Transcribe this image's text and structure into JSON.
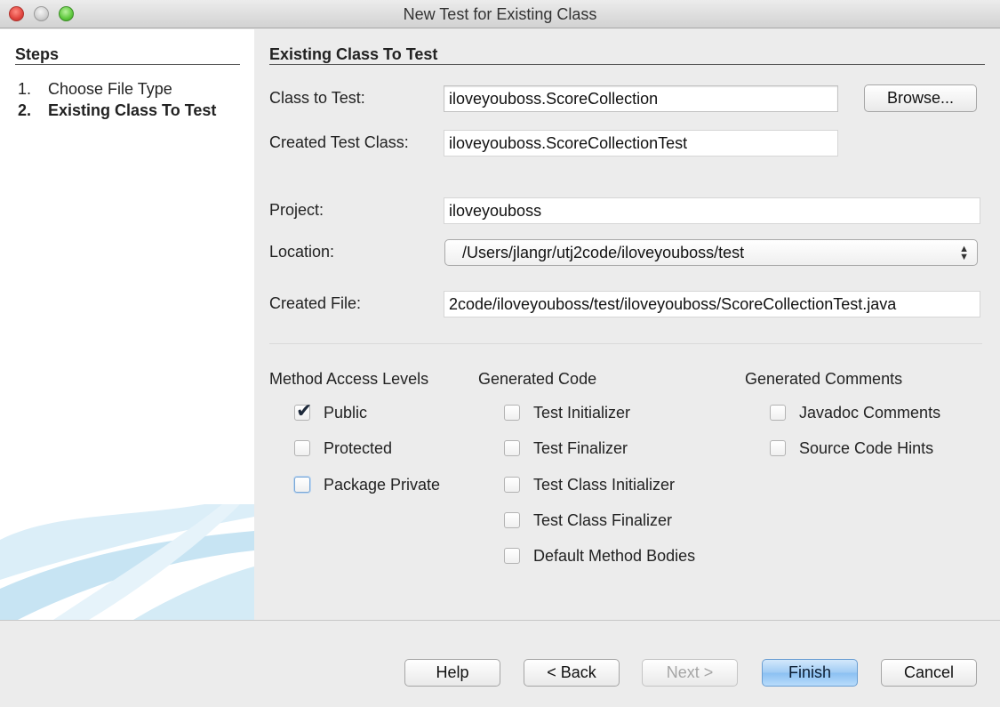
{
  "window": {
    "title": "New Test for Existing Class"
  },
  "steps": {
    "heading": "Steps",
    "items": [
      {
        "num": "1.",
        "label": "Choose File Type"
      },
      {
        "num": "2.",
        "label": "Existing Class To Test"
      }
    ]
  },
  "main": {
    "title": "Existing Class To Test",
    "class_to_test": {
      "label": "Class to Test:",
      "value": "iloveyouboss.ScoreCollection"
    },
    "browse_button": "Browse...",
    "created_test_class": {
      "label": "Created Test Class:",
      "value": "iloveyouboss.ScoreCollectionTest"
    },
    "project": {
      "label": "Project:",
      "value": "iloveyouboss"
    },
    "location": {
      "label": "Location:",
      "value": "/Users/jlangr/utj2code/iloveyouboss/test"
    },
    "created_file": {
      "label": "Created File:",
      "value": "2code/iloveyouboss/test/iloveyouboss/ScoreCollectionTest.java"
    }
  },
  "options": {
    "method_access": {
      "heading": "Method Access Levels",
      "items": [
        {
          "label": "Public",
          "checked": true
        },
        {
          "label": "Protected",
          "checked": false
        },
        {
          "label": "Package Private",
          "checked": false
        }
      ]
    },
    "generated_code": {
      "heading": "Generated Code",
      "items": [
        {
          "label": "Test Initializer",
          "checked": false
        },
        {
          "label": "Test Finalizer",
          "checked": false
        },
        {
          "label": "Test Class Initializer",
          "checked": false
        },
        {
          "label": "Test Class Finalizer",
          "checked": false
        },
        {
          "label": "Default Method Bodies",
          "checked": false
        }
      ]
    },
    "generated_comments": {
      "heading": "Generated Comments",
      "items": [
        {
          "label": "Javadoc Comments",
          "checked": false
        },
        {
          "label": "Source Code Hints",
          "checked": false
        }
      ]
    }
  },
  "buttons": {
    "help": "Help",
    "back": "< Back",
    "next": "Next >",
    "finish": "Finish",
    "cancel": "Cancel"
  },
  "icons": {
    "checkmark": "✔",
    "combo_arrows_up": "▲",
    "combo_arrows_down": "▼"
  },
  "colors": {
    "default_button": "#9fcbf4",
    "close": "#e0443e",
    "zoom": "#5ec83d"
  }
}
